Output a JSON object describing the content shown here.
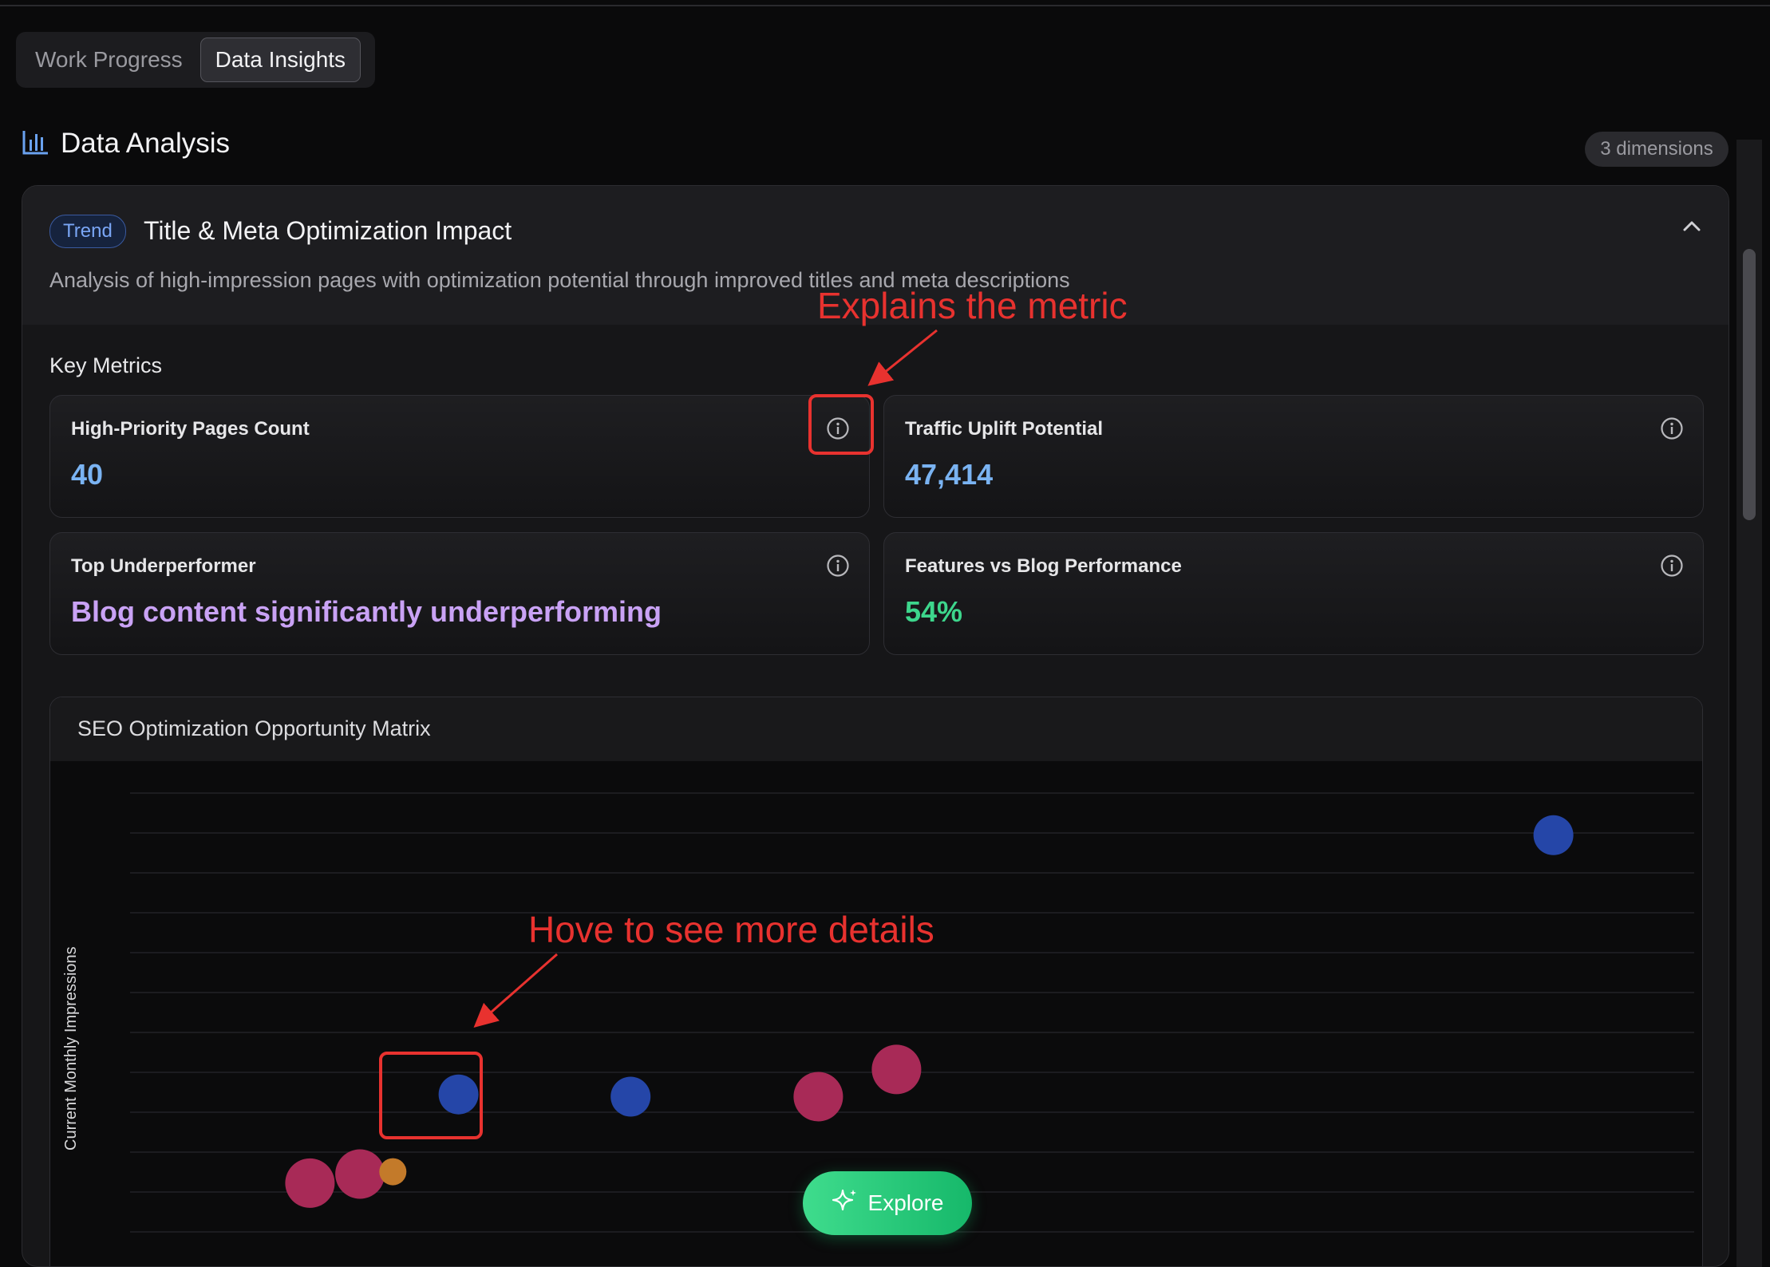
{
  "tabs": [
    {
      "label": "Work Progress",
      "active": false
    },
    {
      "label": "Data Insights",
      "active": true
    }
  ],
  "section": {
    "title": "Data Analysis",
    "icon": "bar-chart-icon",
    "dimensions_badge": "3 dimensions"
  },
  "card": {
    "badge": "Trend",
    "title": "Title & Meta Optimization Impact",
    "description": "Analysis of high-impression pages with optimization potential through improved titles and meta descriptions",
    "key_metrics_label": "Key Metrics",
    "metrics": [
      {
        "label": "High-Priority Pages Count",
        "value": "40",
        "value_color": "#7ab3f2"
      },
      {
        "label": "Traffic Uplift Potential",
        "value": "47,414",
        "value_color": "#7ab3f2"
      },
      {
        "label": "Top Underperformer",
        "value": "Blog content significantly underperforming",
        "value_color": "#c9a2f5"
      },
      {
        "label": "Features vs Blog Performance",
        "value": "54%",
        "value_color": "#3dd68c"
      }
    ]
  },
  "chart_data": {
    "type": "scatter",
    "title": "SEO Optimization Opportunity Matrix",
    "ylabel": "Current Monthly Impressions",
    "xlabel": "",
    "grid": true,
    "ylim": [
      0,
      1
    ],
    "xlim": [
      0,
      1
    ],
    "points": [
      {
        "x": 0.91,
        "y": 0.96,
        "size": "medium",
        "color": "#2546a8"
      },
      {
        "x": 0.21,
        "y": 0.39,
        "size": "medium",
        "color": "#2546a8"
      },
      {
        "x": 0.32,
        "y": 0.385,
        "size": "medium",
        "color": "#2546a8"
      },
      {
        "x": 0.44,
        "y": 0.385,
        "size": "large",
        "color": "#a82a57"
      },
      {
        "x": 0.49,
        "y": 0.445,
        "size": "large",
        "color": "#a82a57"
      },
      {
        "x": 0.115,
        "y": 0.195,
        "size": "large",
        "color": "#a82a57"
      },
      {
        "x": 0.147,
        "y": 0.215,
        "size": "large",
        "color": "#a82a57"
      },
      {
        "x": 0.168,
        "y": 0.22,
        "size": "small",
        "color": "#c37a2a"
      }
    ]
  },
  "explore": {
    "label": "Explore"
  },
  "annotations": {
    "metric_note": "Explains the metric",
    "hover_note": "Hove to see more details"
  },
  "colors": {
    "accent_blue": "#7ab3f2",
    "annotation_red": "#e8322f",
    "explore_green": "#22c97a"
  }
}
